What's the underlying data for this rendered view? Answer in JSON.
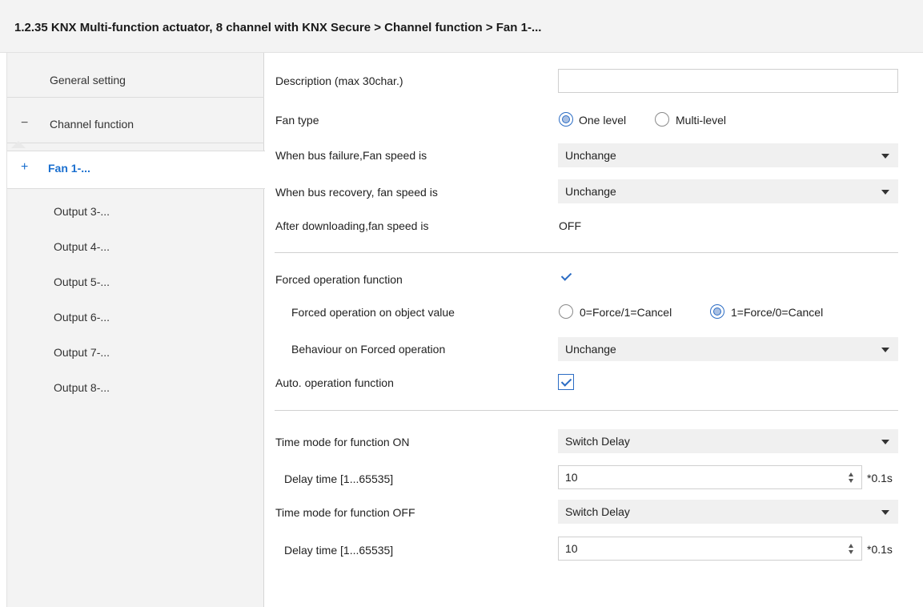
{
  "window": {
    "title": "1.2.35 KNX Multi-function actuator, 8 channel with KNX Secure > Channel function > Fan 1-..."
  },
  "sidebar": {
    "items": [
      {
        "label": "General setting",
        "sign": ""
      },
      {
        "label": "Channel function",
        "sign": "−"
      },
      {
        "label": "Fan 1-...",
        "sign": "+"
      },
      {
        "label": "Output 3-...",
        "sign": ""
      },
      {
        "label": "Output 4-...",
        "sign": ""
      },
      {
        "label": "Output 5-...",
        "sign": ""
      },
      {
        "label": "Output 6-...",
        "sign": ""
      },
      {
        "label": "Output 7-...",
        "sign": ""
      },
      {
        "label": "Output 8-...",
        "sign": ""
      }
    ],
    "active_index": 2
  },
  "params": {
    "description": {
      "label": "Description (max 30char.)",
      "value": ""
    },
    "fan_type": {
      "label": "Fan type",
      "options": [
        "One level",
        "Multi-level"
      ],
      "selected": "One level"
    },
    "bus_failure": {
      "label": "When bus failure,Fan speed is",
      "value": "Unchange"
    },
    "bus_recovery": {
      "label": "When bus recovery, fan speed is",
      "value": "Unchange"
    },
    "after_download": {
      "label": "After downloading,fan speed is",
      "value": "OFF"
    },
    "forced_op": {
      "label": "Forced operation function",
      "checked": true
    },
    "forced_value": {
      "label": "Forced operation on object value",
      "options": [
        "0=Force/1=Cancel",
        "1=Force/0=Cancel"
      ],
      "selected": "1=Force/0=Cancel"
    },
    "forced_behaviour": {
      "label": "Behaviour on Forced operation",
      "value": "Unchange"
    },
    "auto_op": {
      "label": "Auto. operation function",
      "checked": true
    },
    "time_mode_on": {
      "label": "Time mode for function ON",
      "value": "Switch Delay"
    },
    "delay_on": {
      "label": "Delay time [1...65535]",
      "value": "10",
      "unit": "*0.1s"
    },
    "time_mode_off": {
      "label": "Time mode for function OFF",
      "value": "Switch Delay"
    },
    "delay_off": {
      "label": "Delay time [1...65535]",
      "value": "10",
      "unit": "*0.1s"
    }
  },
  "icons": {
    "dropdown": "chevron-down-icon",
    "spin": "spin-arrows-icon",
    "check": "checkmark-icon"
  },
  "colors": {
    "accent": "#2b6cc4",
    "active_nav": "#1a6fcf",
    "sidebar_bg": "#f3f3f3",
    "dropdown_bg": "#f0f0f0"
  }
}
